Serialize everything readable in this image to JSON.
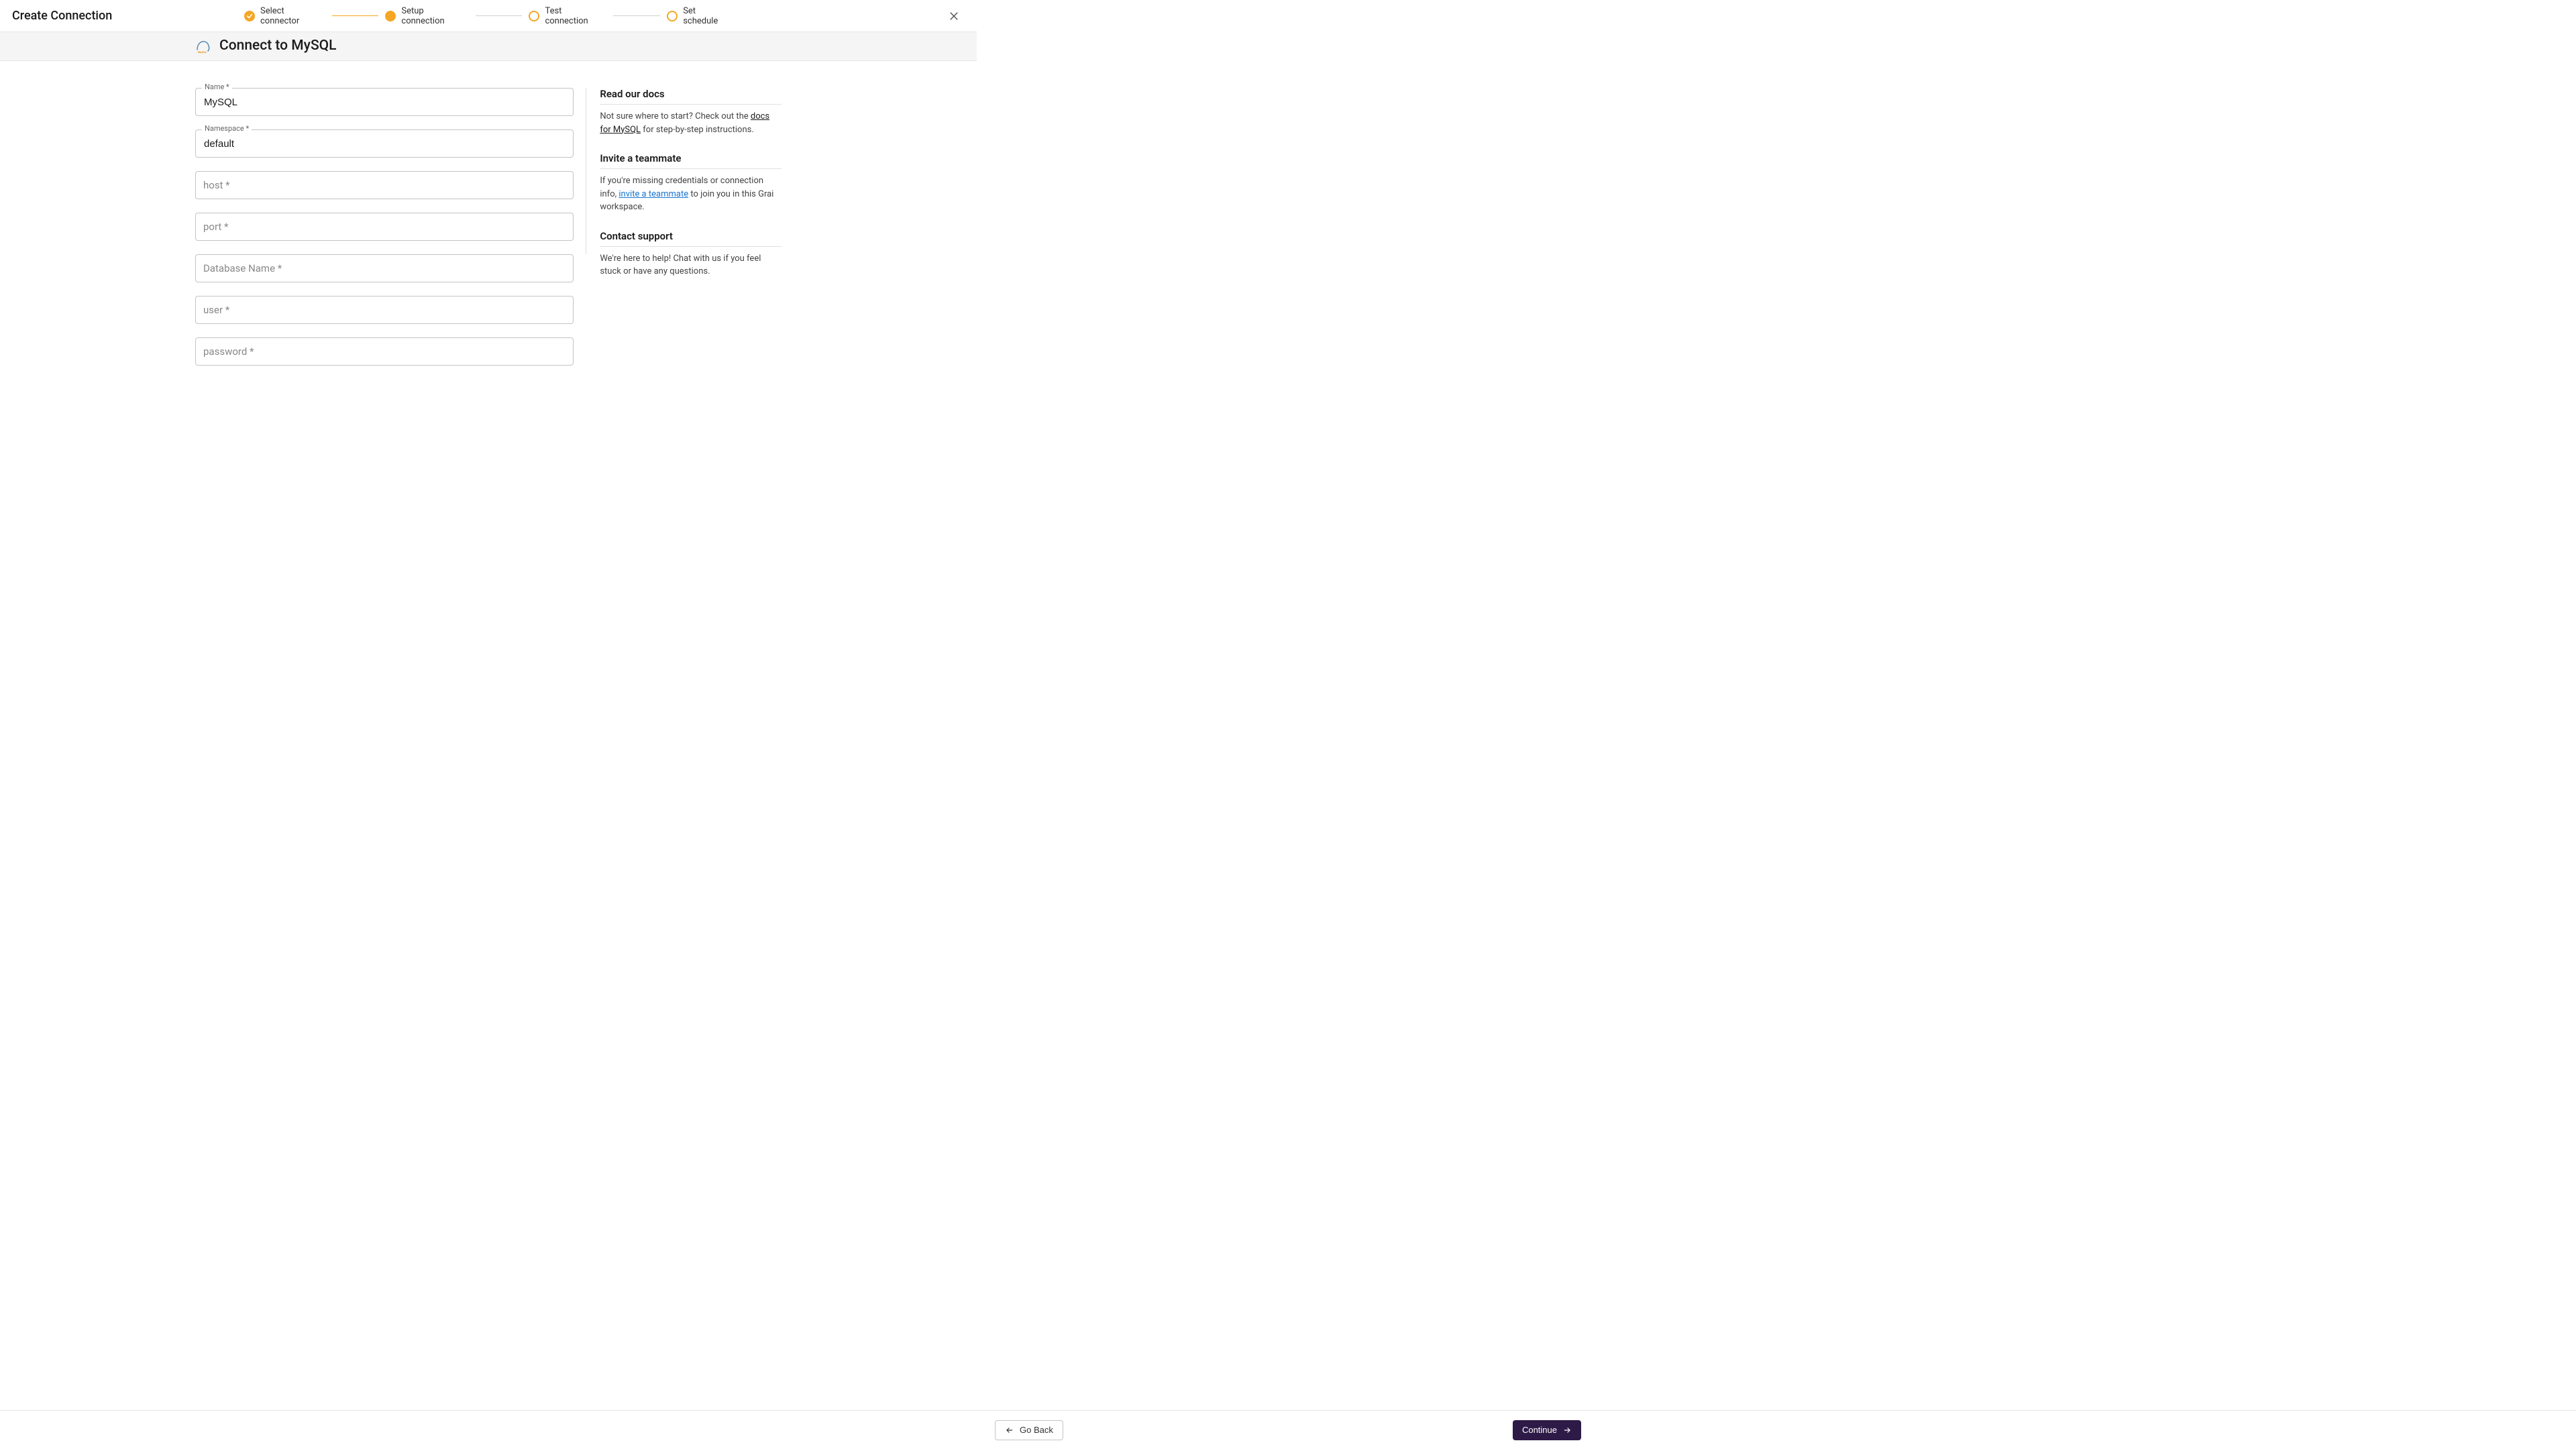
{
  "header": {
    "title": "Create Connection",
    "steps": [
      {
        "label": "Select connector",
        "state": "done"
      },
      {
        "label": "Setup connection",
        "state": "active"
      },
      {
        "label": "Test connection",
        "state": "pending"
      },
      {
        "label": "Set schedule",
        "state": "pending"
      }
    ]
  },
  "subheader": {
    "title": "Connect to MySQL"
  },
  "form": {
    "name": {
      "label": "Name *",
      "value": "MySQL"
    },
    "namespace": {
      "label": "Namespace *",
      "value": "default"
    },
    "host": {
      "label": "host *",
      "value": ""
    },
    "port": {
      "label": "port *",
      "value": ""
    },
    "database": {
      "label": "Database Name *",
      "value": ""
    },
    "user": {
      "label": "user *",
      "value": ""
    },
    "password": {
      "label": "password *",
      "value": ""
    }
  },
  "sidebar": {
    "docs": {
      "heading": "Read our docs",
      "text_pre": "Not sure where to start? Check out the ",
      "link": "docs for MySQL",
      "text_post": " for step-by-step instructions."
    },
    "invite": {
      "heading": "Invite a teammate",
      "text_pre": "If you're missing credentials or connection info, ",
      "link": "invite a teammate",
      "text_post": " to join you in this Grai workspace."
    },
    "support": {
      "heading": "Contact support",
      "text": "We're here to help! Chat with us if you feel stuck or have any questions."
    }
  },
  "footer": {
    "back": "Go Back",
    "continue": "Continue"
  }
}
